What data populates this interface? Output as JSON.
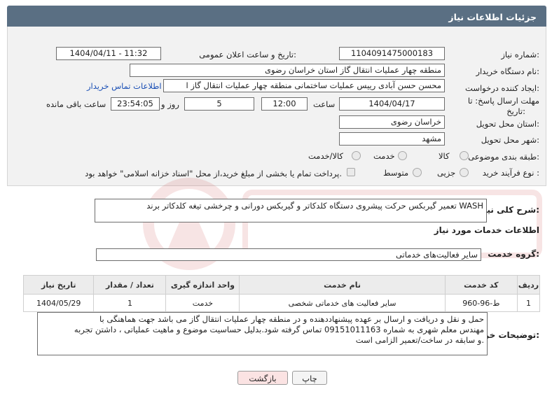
{
  "header": {
    "title": "جزئیات اطلاعات نیاز"
  },
  "form": {
    "need_number": {
      "label": "شماره نیاز:",
      "value": "1104091475000183"
    },
    "announce_datetime": {
      "label": "تاریخ و ساعت اعلان عمومی:",
      "value": "1404/04/11 - 11:32"
    },
    "buyer_org": {
      "label": "نام دستگاه خریدار:",
      "value": "منطقه چهار عملیات انتقال گاز    استان خراسان رضوی"
    },
    "requester": {
      "label": "ایجاد کننده درخواست:",
      "value": "محسن حسن آبادی رییس عملیات ساختمانی منطقه چهار عملیات انتقال گاز   ا",
      "contact_link": "اطلاعات تماس خریدار"
    },
    "deadline": {
      "label_line1": "مهلت ارسال پاسخ: تا",
      "label_line2": "تاریخ:",
      "date": "1404/04/17",
      "time_label": "ساعت",
      "time": "12:00",
      "days": "5",
      "days_label": "روز و",
      "remaining": "23:54:05",
      "remaining_label": "ساعت باقی مانده"
    },
    "province": {
      "label": "استان محل تحویل:",
      "value": "خراسان رضوی"
    },
    "city": {
      "label": "شهر محل تحویل:",
      "value": "مشهد"
    },
    "category": {
      "label": "طبقه بندی موضوعی:",
      "options": [
        "کالا",
        "خدمت",
        "کالا/خدمت"
      ]
    },
    "process": {
      "label": "نوع فرآیند خرید :",
      "options": [
        "جزیی",
        "متوسط"
      ],
      "note": "پرداخت تمام یا بخشی از مبلغ خرید،از محل \"اسناد خزانه اسلامی\" خواهد بود."
    }
  },
  "description": {
    "label": "شرح کلی نیاز:",
    "text": "تعمیر گیربکس حرکت پیشروی دستگاه کلدکاتر و گیربکس دورانی و چرخشی تیغه کلدکاتر برند WASH"
  },
  "services": {
    "section_title": "اطلاعات خدمات مورد نیاز",
    "group_label": "گروه خدمت:",
    "group_value": "سایر فعالیت‌های خدماتی",
    "columns": [
      "ردیف",
      "کد خدمت",
      "نام خدمت",
      "واحد اندازه گیری",
      "تعداد / مقدار",
      "تاریخ نیاز"
    ],
    "rows": [
      {
        "row": "1",
        "code": "ط-96-960",
        "name": "سایر فعالیت های خدماتی شخصی",
        "unit": "خدمت",
        "qty": "1",
        "date": "1404/05/29"
      }
    ]
  },
  "buyer_notes": {
    "label": "توضیحات خریدار:",
    "lines": [
      "حمل و نقل و دریافت و ارسال بر عهده پیشنهاددهنده و در منطقه چهار عملیات انتقال گاز می باشد جهت هماهنگی با",
      "مهندس معلم شهری به شماره 09151011163 تماس گرفته شود.بدلیل حساسیت موضوع و ماهیت عملیاتی ، داشتن تجربه",
      "و سابقه در ساخت/تعمیر الزامی است."
    ]
  },
  "buttons": {
    "print": "چاپ",
    "back": "بازگشت"
  },
  "colors": {
    "header_bg": "#5a6f83",
    "link": "#1a4fb5",
    "back_button_bg": "#fbe3e3",
    "watermark": "#c62828"
  }
}
